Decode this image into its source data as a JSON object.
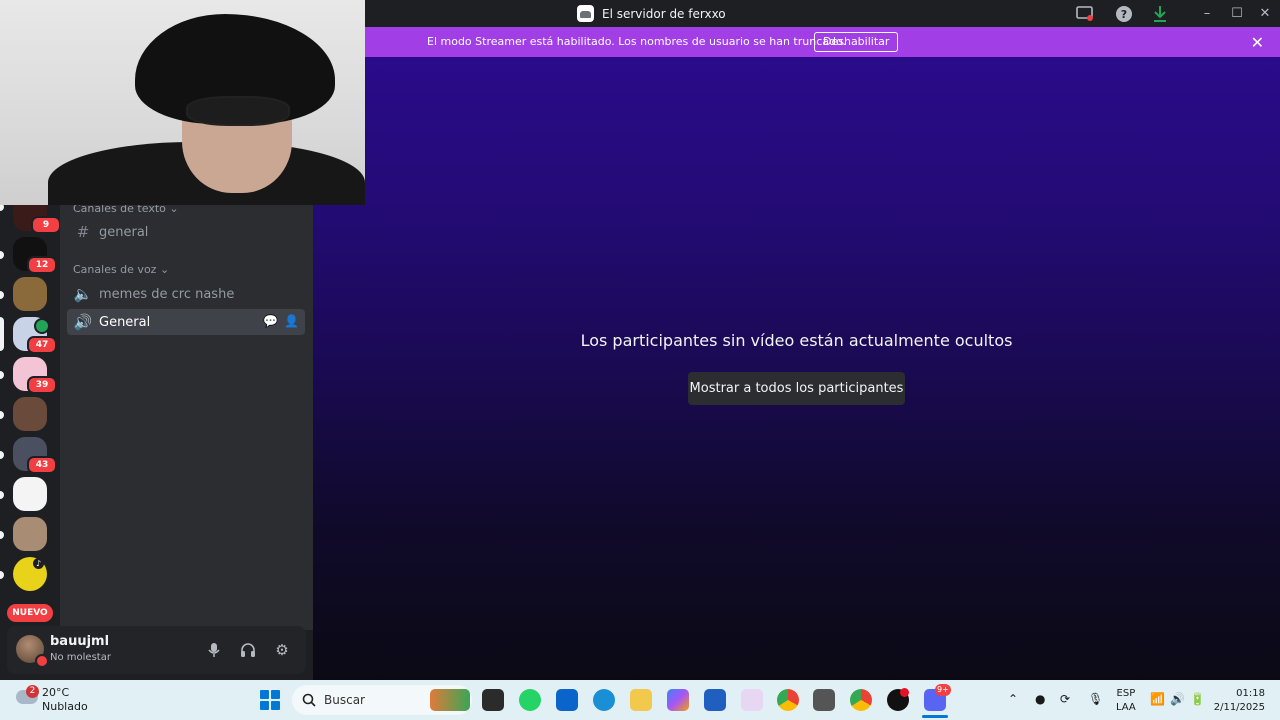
{
  "window": {
    "title": "El servidor de ferxxo"
  },
  "banner": {
    "message": "El modo Streamer está habilitado. Los nombres de usuario se han truncado.",
    "button_label": "Deshabilitar"
  },
  "servers": [
    {
      "badge": "9",
      "color": "#3b1a1a"
    },
    {
      "badge": "12",
      "color": "#111111"
    },
    {
      "badge": "",
      "color": "#8a6a3a"
    },
    {
      "badge": "47",
      "color": "#c9d3e8",
      "active": true
    },
    {
      "badge": "39",
      "color": "#f3c3d6"
    },
    {
      "badge": "",
      "color": "#6a4a3a"
    },
    {
      "badge": "43",
      "color": "#4a5060"
    },
    {
      "badge": "",
      "color": "#f4f4f4"
    },
    {
      "badge": "",
      "color": "#a88c74"
    },
    {
      "badge": "",
      "color": "#e8d21a"
    }
  ],
  "new_label": "NUEVO",
  "sidebar": {
    "text_category": "Canales de texto",
    "voice_category": "Canales de voz",
    "text_channels": [
      {
        "name": "general"
      }
    ],
    "voice_channels": [
      {
        "name": "memes de crc nashe"
      },
      {
        "name": "General"
      }
    ]
  },
  "user": {
    "name": "bauujml",
    "status": "No molestar"
  },
  "stage": {
    "hidden_message": "Los participantes sin vídeo están actualmente ocultos",
    "show_all_label": "Mostrar a todos los participantes"
  },
  "taskbar": {
    "weather_badge": "2",
    "temperature": "20°C",
    "condition": "Nublado",
    "search_placeholder": "Buscar",
    "discord_badge": "9+",
    "lang_top": "ESP",
    "lang_bottom": "LAA",
    "time": "01:18",
    "date": "2/11/2025"
  }
}
